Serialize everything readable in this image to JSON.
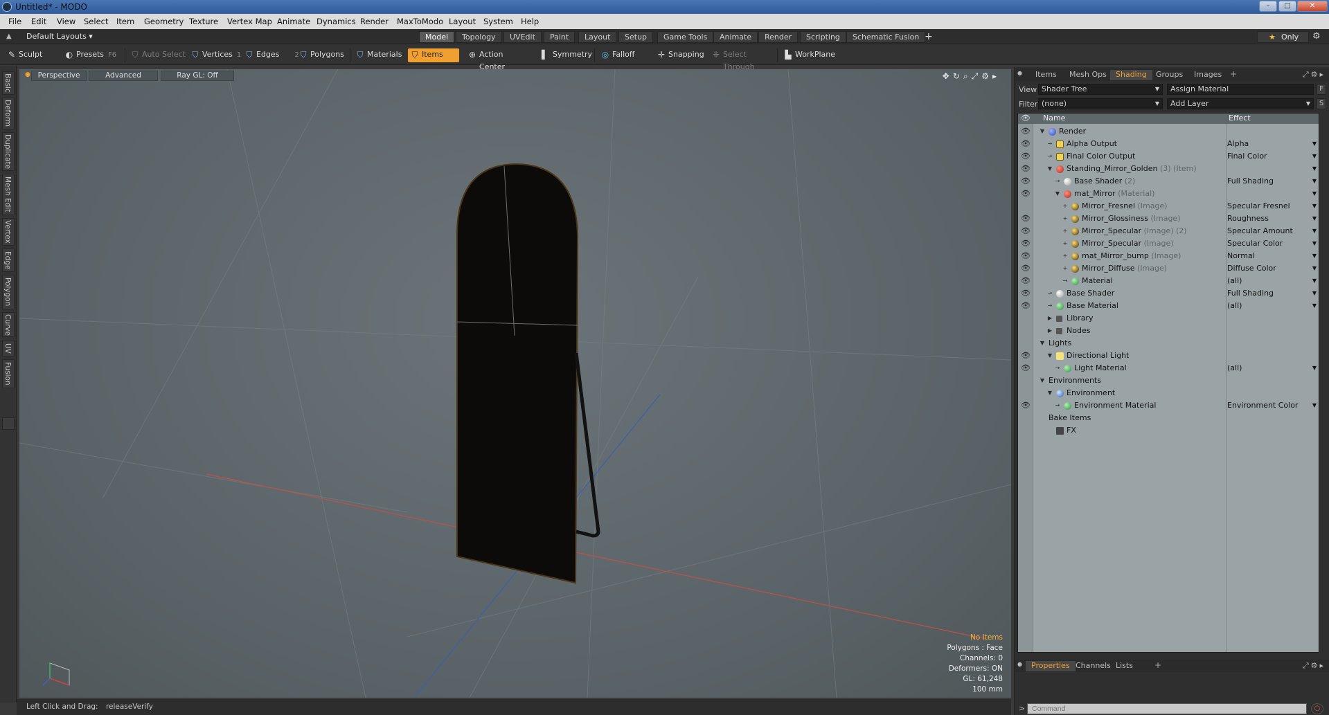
{
  "window": {
    "title": "Untitled* - MODO",
    "controls": {
      "minimize": "–",
      "maximize": "□",
      "close": "✕"
    }
  },
  "menu": [
    "File",
    "Edit",
    "View",
    "Select",
    "Item",
    "Geometry",
    "Texture",
    "Vertex Map",
    "Animate",
    "Dynamics",
    "Render",
    "MaxToModo",
    "Layout",
    "System",
    "Help"
  ],
  "layout_bar": {
    "layout_name": "Default Layouts ▾",
    "tabs": [
      "Model",
      "Topology",
      "UVEdit",
      "Paint",
      "Layout",
      "Setup",
      "Game Tools",
      "Animate",
      "Render",
      "Scripting",
      "Schematic Fusion"
    ],
    "active_tab": "Model",
    "add": "+",
    "only": "Only"
  },
  "toolbar": {
    "sculpt": "Sculpt",
    "presets": "Presets",
    "presets_key": "F6",
    "auto_select": "Auto Select",
    "vertices": "Vertices",
    "vertices_key": "1",
    "edges": "Edges",
    "edges_key": "2",
    "polygons": "Polygons",
    "materials": "Materials",
    "items": "Items",
    "action_center": "Action Center",
    "symmetry": "Symmetry",
    "falloff": "Falloff",
    "snapping": "Snapping",
    "select_through": "Select Through",
    "workplane": "WorkPlane"
  },
  "left_tabs": [
    "Basic",
    "Deform",
    "Duplicate",
    "Mesh Edit",
    "Vertex",
    "Edge",
    "Polygon",
    "Curve",
    "UV",
    "Fusion"
  ],
  "viewport": {
    "perspective": "Perspective",
    "advanced": "Advanced",
    "raygl": "Ray GL: Off",
    "hud": {
      "no_items": "No Items",
      "polygons": "Polygons : Face",
      "channels": "Channels: 0",
      "deformers": "Deformers: ON",
      "gl": "GL: 61,248",
      "scale": "100 mm"
    }
  },
  "status": {
    "hint": "Left Click and Drag:",
    "command": "releaseVerify"
  },
  "right_panel": {
    "top_tabs": [
      "Items",
      "Mesh Ops",
      "Shading",
      "Groups",
      "Images"
    ],
    "active_top_tab": "Shading",
    "add": "+",
    "view_label": "View",
    "view_value": "Shader Tree",
    "assign_material": "Assign Material",
    "f_button": "F",
    "filter_label": "Filter",
    "filter_value": "(none)",
    "add_layer": "Add Layer",
    "s_button": "S",
    "tree_header": {
      "name": "Name",
      "effect": "Effect"
    },
    "tree": [
      {
        "indent": 0,
        "twisty": "▼",
        "icon": "render",
        "name": "Render",
        "type": "",
        "effect": "",
        "eye": true
      },
      {
        "indent": 1,
        "twisty": "→",
        "icon": "output",
        "name": "Alpha Output",
        "type": "",
        "effect": "Alpha",
        "eye": true
      },
      {
        "indent": 1,
        "twisty": "→",
        "icon": "output",
        "name": "Final Color Output",
        "type": "",
        "effect": "Final Color",
        "eye": true
      },
      {
        "indent": 1,
        "twisty": "▼",
        "icon": "item",
        "name": "Standing_Mirror_Golden",
        "type": "(3) (Item)",
        "effect": "",
        "eye": true
      },
      {
        "indent": 2,
        "twisty": "→",
        "icon": "shader",
        "name": "Base Shader",
        "type": "(2)",
        "effect": "Full Shading",
        "eye": true
      },
      {
        "indent": 2,
        "twisty": "▼",
        "icon": "material-red",
        "name": "mat_Mirror",
        "type": "(Material)",
        "effect": "",
        "eye": true
      },
      {
        "indent": 3,
        "twisty": "+",
        "icon": "image",
        "name": "Mirror_Fresnel",
        "type": "(Image)",
        "effect": "Specular Fresnel",
        "eye": false
      },
      {
        "indent": 3,
        "twisty": "+",
        "icon": "image",
        "name": "Mirror_Glossiness",
        "type": "(Image)",
        "effect": "Roughness",
        "eye": true
      },
      {
        "indent": 3,
        "twisty": "+",
        "icon": "image",
        "name": "Mirror_Specular",
        "type": "(Image) (2)",
        "effect": "Specular Amount",
        "eye": true
      },
      {
        "indent": 3,
        "twisty": "+",
        "icon": "image",
        "name": "Mirror_Specular",
        "type": "(Image)",
        "effect": "Specular Color",
        "eye": true
      },
      {
        "indent": 3,
        "twisty": "+",
        "icon": "image",
        "name": "mat_Mirror_bump",
        "type": "(Image)",
        "effect": "Normal",
        "eye": true
      },
      {
        "indent": 3,
        "twisty": "+",
        "icon": "image",
        "name": "Mirror_Diffuse",
        "type": "(Image)",
        "effect": "Diffuse Color",
        "eye": true
      },
      {
        "indent": 3,
        "twisty": "→",
        "icon": "material",
        "name": "Material",
        "type": "",
        "effect": "(all)",
        "eye": true
      },
      {
        "indent": 1,
        "twisty": "→",
        "icon": "shader",
        "name": "Base Shader",
        "type": "",
        "effect": "Full Shading",
        "eye": true
      },
      {
        "indent": 1,
        "twisty": "→",
        "icon": "material",
        "name": "Base Material",
        "type": "",
        "effect": "(all)",
        "eye": true
      },
      {
        "indent": 1,
        "twisty": "▶",
        "icon": "folder",
        "name": "Library",
        "type": "",
        "effect": "",
        "eye": false
      },
      {
        "indent": 1,
        "twisty": "▶",
        "icon": "folder",
        "name": "Nodes",
        "type": "",
        "effect": "",
        "eye": false
      },
      {
        "indent": 0,
        "twisty": "▼",
        "icon": "none",
        "name": "Lights",
        "type": "",
        "effect": "",
        "eye": false
      },
      {
        "indent": 1,
        "twisty": "▼",
        "icon": "light",
        "name": "Directional Light",
        "type": "",
        "effect": "",
        "eye": true
      },
      {
        "indent": 2,
        "twisty": "→",
        "icon": "material",
        "name": "Light Material",
        "type": "",
        "effect": "(all)",
        "eye": true
      },
      {
        "indent": 0,
        "twisty": "▼",
        "icon": "none",
        "name": "Environments",
        "type": "",
        "effect": "",
        "eye": false
      },
      {
        "indent": 1,
        "twisty": "▼",
        "icon": "env",
        "name": "Environment",
        "type": "",
        "effect": "",
        "eye": false
      },
      {
        "indent": 2,
        "twisty": "→",
        "icon": "material",
        "name": "Environment Material",
        "type": "",
        "effect": "Environment Color",
        "eye": true
      },
      {
        "indent": 0,
        "twisty": "",
        "icon": "none",
        "name": "Bake Items",
        "type": "",
        "effect": "",
        "eye": false
      },
      {
        "indent": 1,
        "twisty": "",
        "icon": "fx",
        "name": "FX",
        "type": "",
        "effect": "",
        "eye": false
      }
    ],
    "bottom_tabs": [
      "Properties",
      "Channels",
      "Lists"
    ],
    "active_bottom_tab": "Properties",
    "command_prompt": ">",
    "command_placeholder": "Command"
  }
}
